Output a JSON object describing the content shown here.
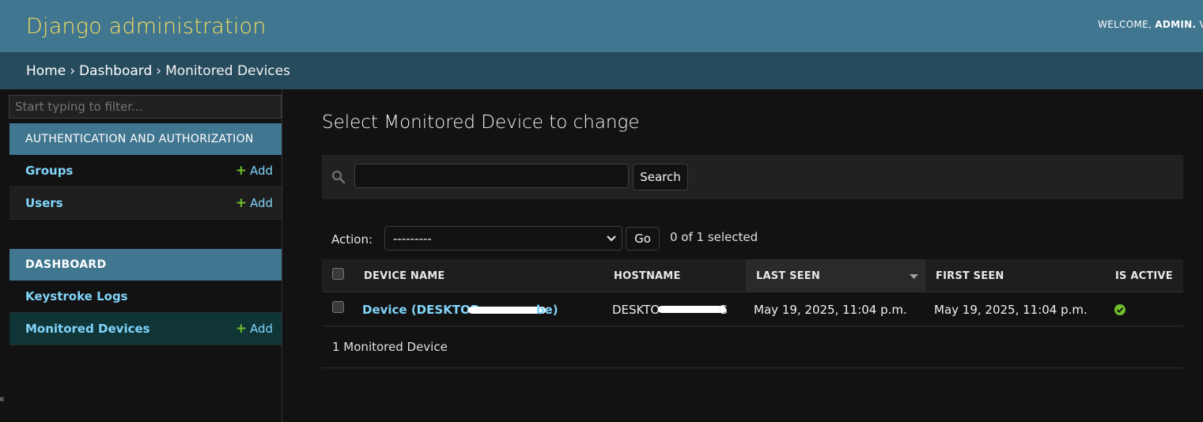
{
  "header": {
    "branding": "Django administration",
    "welcome": "WELCOME,",
    "user": "ADMIN.",
    "tail": "V"
  },
  "breadcrumbs": [
    "Home",
    "Dashboard",
    "Monitored Devices"
  ],
  "sidebar": {
    "filter_placeholder": "Start typing to filter...",
    "apps": [
      {
        "caption": "AUTHENTICATION AND AUTHORIZATION",
        "models": [
          {
            "name": "Groups",
            "add": "Add"
          },
          {
            "name": "Users",
            "add": "Add"
          }
        ]
      },
      {
        "caption": "DASHBOARD",
        "models": [
          {
            "name": "Keystroke Logs"
          },
          {
            "name": "Monitored Devices",
            "add": "Add"
          }
        ]
      }
    ],
    "collapse_glyph": "«"
  },
  "main": {
    "title": "Select Monitored Device to change",
    "search_button": "Search",
    "action_label": "Action:",
    "action_selected": "---------",
    "go_button": "Go",
    "selection_counter": "0 of 1 selected",
    "columns": [
      "DEVICE NAME",
      "HOSTNAME",
      "LAST SEEN",
      "FIRST SEEN",
      "IS ACTIVE"
    ],
    "rows": [
      {
        "device_name_start": "Device (DESKTOP",
        "device_name_end": "be)",
        "hostname_start": "DESKTO",
        "hostname_end": "G",
        "last_seen": "May 19, 2025, 11:04 p.m.",
        "first_seen": "May 19, 2025, 11:04 p.m.",
        "is_active": true
      }
    ],
    "paginator": "1 Monitored Device"
  },
  "colors": {
    "header": "#417690",
    "breadcrumbs": "#264b5d",
    "accent_yellow": "#f5dd5d",
    "link": "#81d4fa",
    "add_plus": "#70bf2b",
    "active_icon": "#70bf2b"
  },
  "icons": {
    "search": "search-icon",
    "add": "plus-icon",
    "sort": "sort-descending-icon",
    "active": "check-circle-icon",
    "select_arrow": "chevron-down-icon"
  }
}
